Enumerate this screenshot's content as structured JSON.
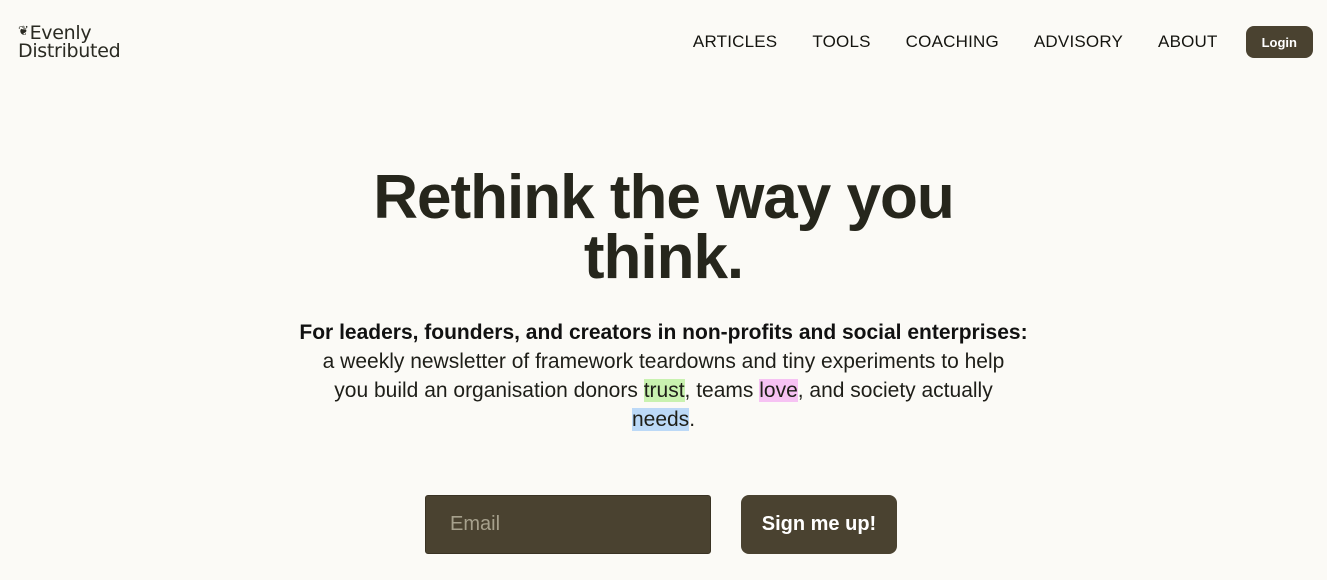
{
  "brand": {
    "line1": "Evenly",
    "line2": "Distributed",
    "bird_glyph": "❦"
  },
  "nav": {
    "items": [
      {
        "label": "ARTICLES"
      },
      {
        "label": "TOOLS"
      },
      {
        "label": "COACHING"
      },
      {
        "label": "ADVISORY"
      },
      {
        "label": "ABOUT"
      }
    ],
    "login_label": "Login"
  },
  "hero": {
    "title_line1": "Rethink the way you",
    "title_line2": "think.",
    "lead": "For leaders, founders, and creators in non-profits and social enterprises:",
    "body_part1": "a weekly newsletter of framework teardowns and tiny experiments to help you build an organisation donors ",
    "word_trust": "trust",
    "body_part2": ", teams ",
    "word_love": "love",
    "body_part3": ", and society actually ",
    "word_needs": "needs",
    "body_part4": "."
  },
  "signup": {
    "email_placeholder": "Email",
    "email_value": "",
    "button_label": "Sign me up!"
  },
  "colors": {
    "background": "#fbfaf6",
    "brand_dark": "#4a4230",
    "highlight_trust": "#c9f2b0",
    "highlight_love": "#f6c2f3",
    "highlight_needs": "#bcd9f7"
  }
}
